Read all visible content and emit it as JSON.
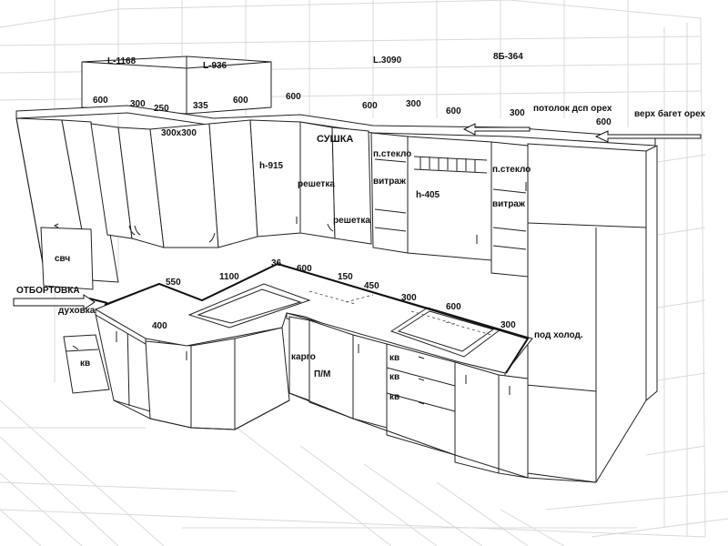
{
  "colors": {
    "line": "#222222",
    "room_grid": "#d9d9d9",
    "background": "#ffffff"
  },
  "labels": {
    "l1168": "L-1168",
    "l936": "L-936",
    "l3090": "L.3090",
    "b364": "8Б-364",
    "d600a": "600",
    "d300a": "300",
    "d250": "250",
    "d335": "335",
    "d600b": "600",
    "d600c": "600",
    "d600d": "600",
    "d300b": "300",
    "d600e": "600",
    "d300c": "300",
    "d600f": "600",
    "d300x300": "300x300",
    "potolok": "потолок дсп орех",
    "verh_baget": "верх багет орех",
    "sushka": "СУШКА",
    "h915": "h-915",
    "reshetka1": "решетка",
    "reshetka2": "решетка",
    "pstek1": "п.стекло",
    "vitrazh1": "витраж",
    "h405": "h-405",
    "pstek2": "п.стекло",
    "vitrazh2": "витраж",
    "svch": "свч",
    "otbortovka": "ОТБОРТОВКА",
    "duhovka": "духовка",
    "kv1": "кв",
    "d550": "550",
    "d1100": "1100",
    "d36": "36",
    "d600g": "600",
    "d150": "150",
    "d450": "450",
    "d300d": "300",
    "d600h": "600",
    "d300e": "300",
    "d400": "400",
    "pod_holod": "под холод.",
    "kargo": "карго",
    "pm": "П/М",
    "kv2": "кв",
    "kv3": "кв",
    "kv4": "кв"
  }
}
